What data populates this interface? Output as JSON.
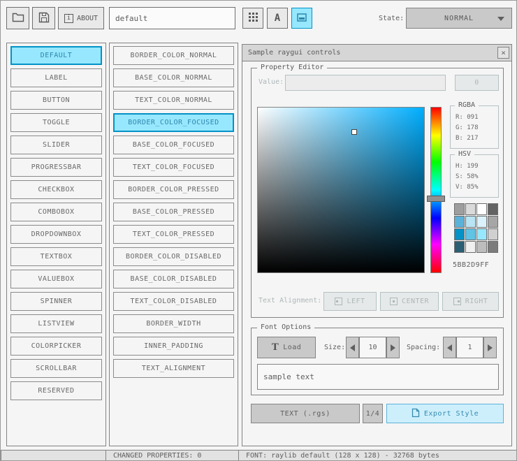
{
  "toolbar": {
    "about_button": {
      "icon_glyph": "i",
      "label": "ABOUT"
    },
    "style_name_input": "default",
    "font_button_label": "A",
    "state_label": "State:",
    "state_dropdown_value": "NORMAL"
  },
  "controls": {
    "items": [
      "DEFAULT",
      "LABEL",
      "BUTTON",
      "TOGGLE",
      "SLIDER",
      "PROGRESSBAR",
      "CHECKBOX",
      "COMBOBOX",
      "DROPDOWNBOX",
      "TEXTBOX",
      "VALUEBOX",
      "SPINNER",
      "LISTVIEW",
      "COLORPICKER",
      "SCROLLBAR",
      "RESERVED"
    ],
    "selected_index": 0
  },
  "properties": {
    "items": [
      "BORDER_COLOR_NORMAL",
      "BASE_COLOR_NORMAL",
      "TEXT_COLOR_NORMAL",
      "BORDER_COLOR_FOCUSED",
      "BASE_COLOR_FOCUSED",
      "TEXT_COLOR_FOCUSED",
      "BORDER_COLOR_PRESSED",
      "BASE_COLOR_PRESSED",
      "TEXT_COLOR_PRESSED",
      "BORDER_COLOR_DISABLED",
      "BASE_COLOR_DISABLED",
      "TEXT_COLOR_DISABLED",
      "BORDER_WIDTH",
      "INNER_PADDING",
      "TEXT_ALIGNMENT"
    ],
    "selected_index": 3
  },
  "sample_window": {
    "title": "Sample raygui controls",
    "close_glyph": "×",
    "property_editor": {
      "group_label": "Property Editor",
      "value_label": "Value:",
      "value_input": "",
      "value_button_label": "0",
      "picker": {
        "hue_deg": 199,
        "saturation_pct": 58,
        "value_pct": 85
      },
      "rgba_box": {
        "label": "RGBA",
        "rows": [
          "R: 091",
          "G: 178",
          "B: 217"
        ]
      },
      "hsv_box": {
        "label": "HSV",
        "rows": [
          "H: 199",
          "S: 58%",
          "V: 85%"
        ]
      },
      "palette": [
        "#9e9e9e",
        "#dadada",
        "#ffffff",
        "#636363",
        "#5bb2d9",
        "#b8e4f4",
        "#d9f2fb",
        "#a6a6a6",
        "#0492c7",
        "#62c4e5",
        "#97e8ff",
        "#d0d0d0",
        "#2b5f73",
        "#f0f0f0",
        "#bdbdbd",
        "#7c7c7c"
      ],
      "hex_value": "5BB2D9FF",
      "text_alignment_label": "Text Alignment:",
      "align_left_label": "LEFT",
      "align_center_label": "CENTER",
      "align_right_label": "RIGHT"
    },
    "font_options": {
      "group_label": "Font Options",
      "load_button": {
        "icon_glyph": "T",
        "label": "Load"
      },
      "size_label": "Size:",
      "size_value": "10",
      "spacing_label": "Spacing:",
      "spacing_value": "1",
      "sample_text_value": "sample text"
    },
    "footer": {
      "format_button_label": "TEXT (.rgs)",
      "page_indicator": "1/4",
      "export_button_label": "Export Style"
    }
  },
  "statusbar": {
    "left_text": "",
    "changed_properties": "CHANGED PROPERTIES: 0",
    "font_info": "FONT: raylib default (128 x 128) - 32768 bytes"
  },
  "accent_colors": {
    "pressed_bg": "#97e8ff",
    "pressed_border": "#0492c7",
    "focused_bg": "#cdeffc",
    "focused_border": "#5bb2d9"
  }
}
